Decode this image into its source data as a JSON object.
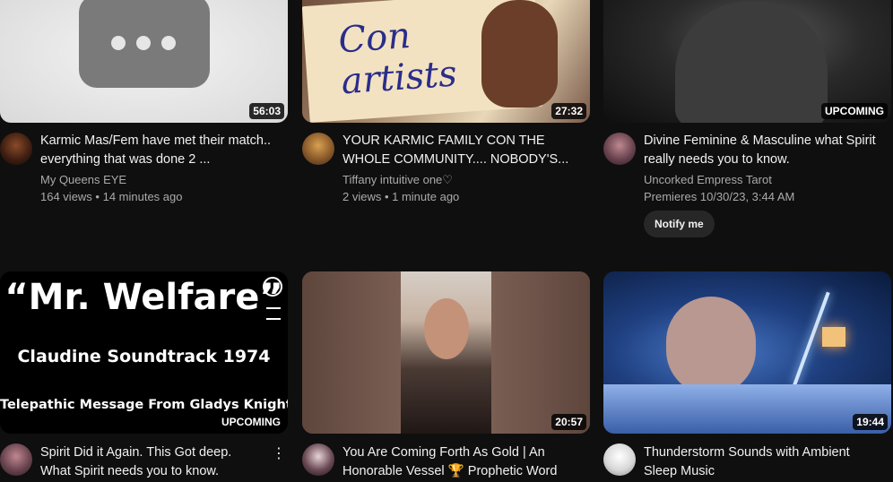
{
  "videos": [
    {
      "title": "Karmic Mas/Fem have met their match.. everything that was done 2 ...",
      "channel": "My Queens EYE",
      "stats": "164 views • 14 minutes ago",
      "badge": "56:03",
      "avatar_icon": "channel-avatar"
    },
    {
      "title": "YOUR KARMIC FAMILY CON THE WHOLE COMMUNITY.... NOBODY'S...",
      "channel": "Tiffany intuitive one♡",
      "stats": "2 views • 1 minute ago",
      "badge": "27:32",
      "thumb_text_line1": "Con",
      "thumb_text_line2": "artists"
    },
    {
      "title": "Divine Feminine & Masculine what Spirit really needs you to know.",
      "channel": "Uncorked Empress Tarot",
      "stats": "Premieres 10/30/23, 3:44 AM",
      "badge": "UPCOMING",
      "notify_label": "Notify me"
    },
    {
      "title": "Spirit Did it Again. This Got deep. What Spirit needs you to know.",
      "badge": "UPCOMING",
      "thumb_heading": "“Mr. Welfare”",
      "thumb_sub": "Claudine Soundtrack 1974",
      "thumb_caption": "Telepathic Message From Gladys Knight",
      "menu_icon": "⋮"
    },
    {
      "title": "You Are Coming Forth As Gold | An Honorable Vessel 🏆 Prophetic Word",
      "badge": "20:57"
    },
    {
      "title": "Thunderstorm Sounds with Ambient Sleep Music",
      "badge": "19:44"
    }
  ],
  "colors": {
    "background": "#0f0f0f",
    "text_primary": "#f1f1f1",
    "text_secondary": "#aaaaaa",
    "chip": "#272727"
  }
}
